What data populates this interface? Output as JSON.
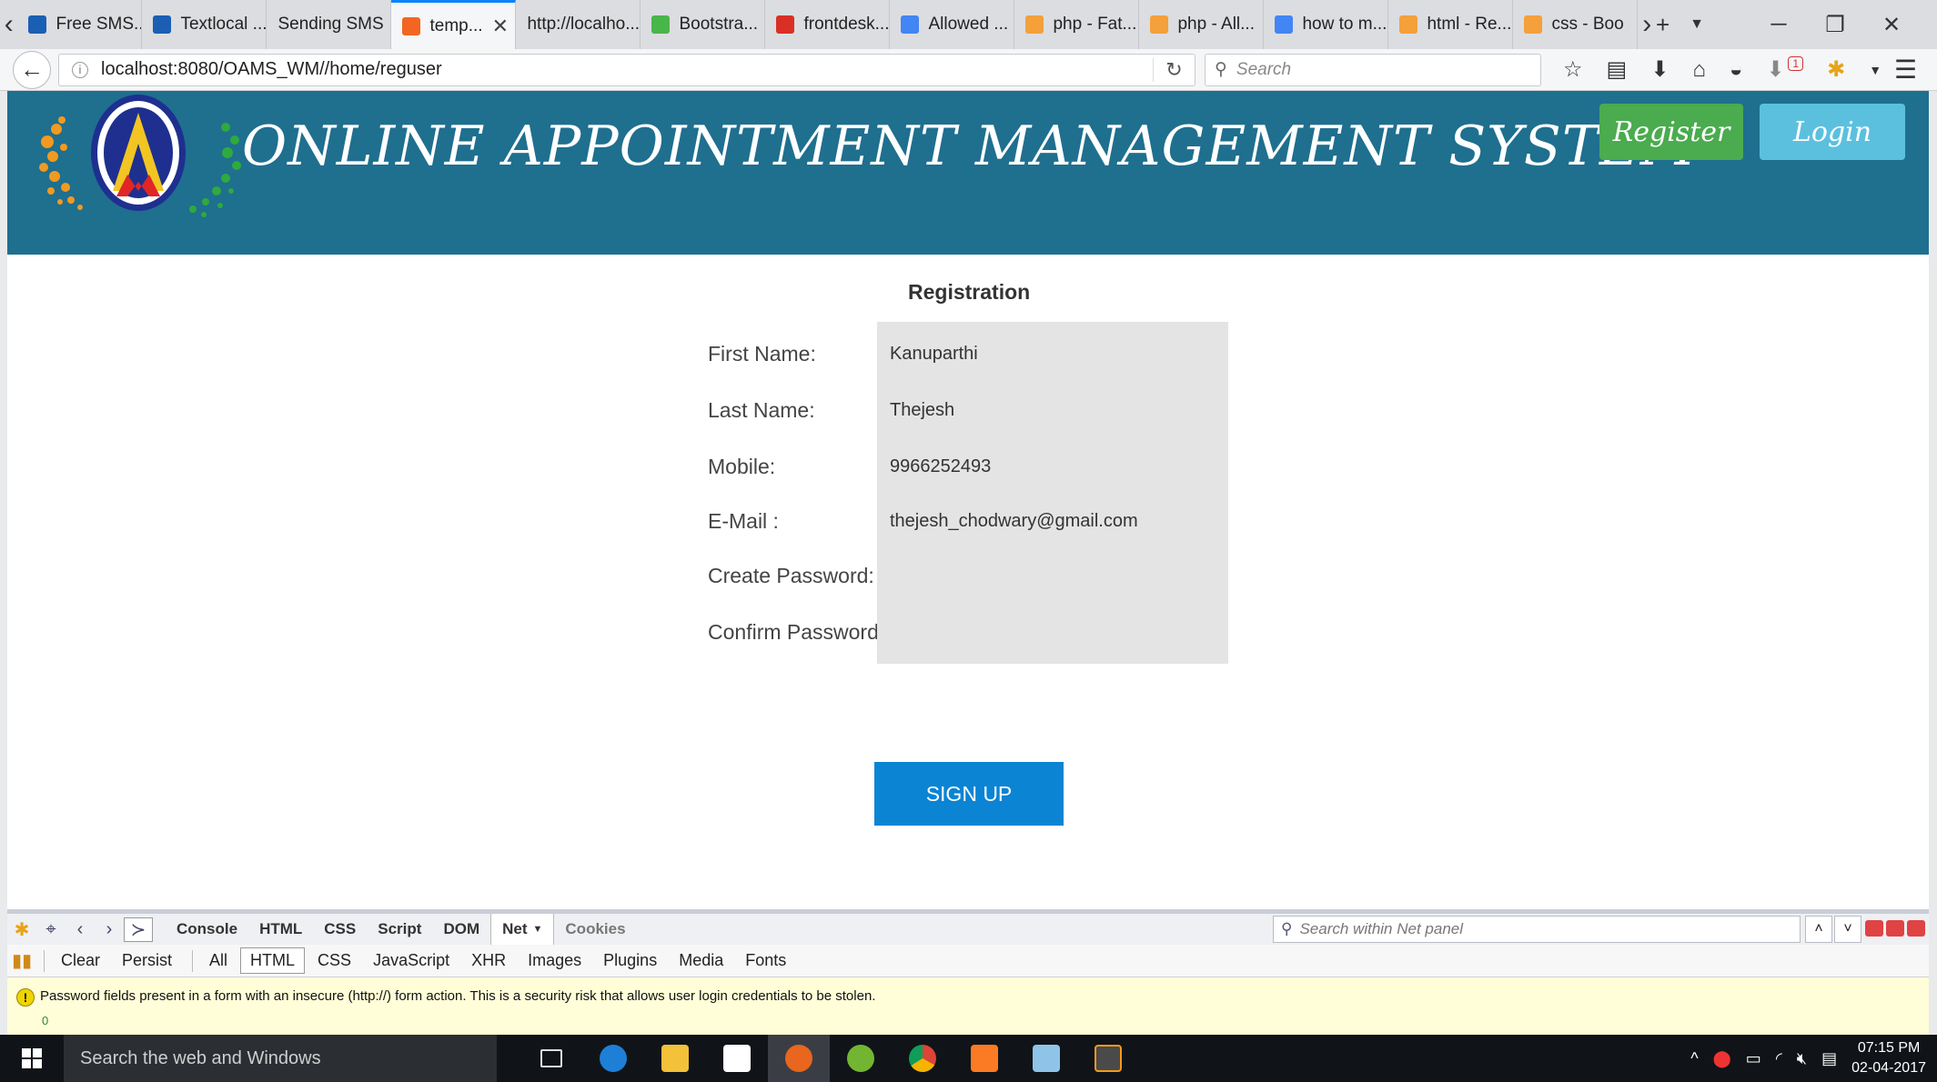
{
  "browser": {
    "tabs": [
      {
        "label": "Free SMS...",
        "color": "#1a5fb4"
      },
      {
        "label": "Textlocal ...",
        "color": "#1a5fb4"
      },
      {
        "label": "Sending SMS",
        "color": ""
      },
      {
        "label": "temp...",
        "color": "#f26522",
        "active": true
      },
      {
        "label": "http://localho...",
        "color": ""
      },
      {
        "label": "Bootstra...",
        "color": "#49b649"
      },
      {
        "label": "frontdesk...",
        "color": "#d93025"
      },
      {
        "label": "Allowed ...",
        "color": "#4285f4"
      },
      {
        "label": "php - Fat...",
        "color": "#f4a03b"
      },
      {
        "label": "php - All...",
        "color": "#f4a03b"
      },
      {
        "label": "how to m...",
        "color": "#4285f4"
      },
      {
        "label": "html - Re...",
        "color": "#f4a03b"
      },
      {
        "label": "css - Boo",
        "color": "#f4a03b"
      }
    ],
    "url": "localhost:8080/OAMS_WM//home/reguser",
    "search_placeholder": "Search",
    "download_badge": "1"
  },
  "site": {
    "title": "ONLINE APPOINTMENT MANAGEMENT SYSTEM",
    "register_label": "Register",
    "login_label": "Login",
    "header_color": "#1f6f8f"
  },
  "form": {
    "title": "Registration",
    "fields": [
      {
        "label": "First Name:",
        "value": "Kanuparthi"
      },
      {
        "label": "Last Name:",
        "value": "Thejesh"
      },
      {
        "label": "Mobile:",
        "value": "9966252493"
      },
      {
        "label": "E-Mail :",
        "value": "thejesh_chodwary@gmail.com"
      },
      {
        "label": "Create Password:",
        "value": ""
      },
      {
        "label": "Confirm Password:",
        "value": ""
      }
    ],
    "submit_label": "SIGN UP",
    "submit_color": "#0b84d3"
  },
  "devtools": {
    "tabs": [
      "Console",
      "HTML",
      "CSS",
      "Script",
      "DOM",
      "Net",
      "Cookies"
    ],
    "active_tab": "Net",
    "search_placeholder": "Search within Net panel",
    "clear_label": "Clear",
    "persist_label": "Persist",
    "filters": [
      "All",
      "HTML",
      "CSS",
      "JavaScript",
      "XHR",
      "Images",
      "Plugins",
      "Media",
      "Fonts"
    ],
    "active_filter": "HTML",
    "warning": "Password fields present in a form with an insecure (http://) form action. This is a security risk that allows user login credentials to be stolen.",
    "warning_count": "0"
  },
  "taskbar": {
    "search_placeholder": "Search the web and Windows",
    "time": "07:15 PM",
    "date": "02-04-2017"
  }
}
